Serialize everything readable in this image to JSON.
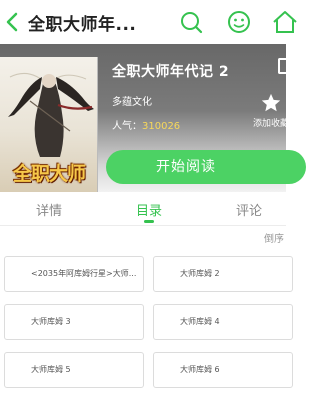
{
  "header": {
    "title": "全职大师年...",
    "icons": [
      "back-arrow-icon",
      "search-icon",
      "face-icon",
      "home-icon"
    ]
  },
  "book": {
    "cover_logo_text": "全职大师",
    "title": "全职大师年代记 2",
    "author": "多蕴文化",
    "popularity_label": "人气：",
    "popularity_value": "310026",
    "collect_label": "添加收藏",
    "read_button": "开始阅读"
  },
  "tabs": [
    {
      "label": "详情",
      "active": false
    },
    {
      "label": "目录",
      "active": true
    },
    {
      "label": "评论",
      "active": false
    }
  ],
  "sort_label": "倒序",
  "chapters": [
    {
      "label": "<2035年阿库姆行星>大师..."
    },
    {
      "label": "大师库姆 2"
    },
    {
      "label": "大师库姆 3"
    },
    {
      "label": "大师库姆 4"
    },
    {
      "label": "大师库姆 5"
    },
    {
      "label": "大师库姆 6"
    }
  ],
  "colors": {
    "accent": "#35c24f",
    "button": "#4cd264",
    "popularity": "#f7d85a"
  }
}
